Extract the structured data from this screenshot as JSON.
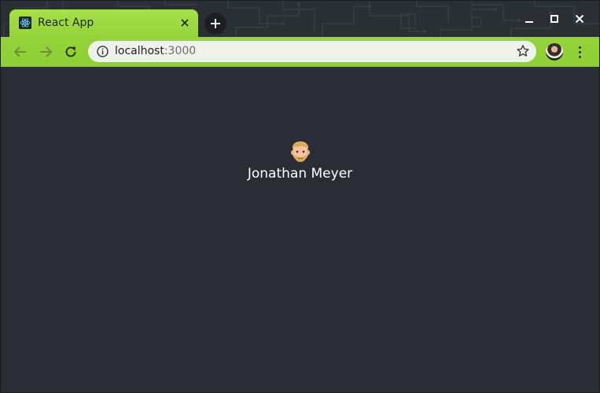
{
  "browser": {
    "tab": {
      "title": "React App",
      "favicon": "react-icon",
      "close_icon": "close-icon"
    },
    "new_tab_icon": "plus-icon",
    "window_controls": [
      "minimize-icon",
      "maximize-icon",
      "close-icon"
    ],
    "toolbar": {
      "back_icon": "arrow-left-icon",
      "forward_icon": "arrow-right-icon",
      "reload_icon": "reload-icon",
      "omnibox": {
        "info_icon": "info-icon",
        "host": "localhost",
        "port": ":3000",
        "bookmark_icon": "star-icon"
      },
      "profile_icon": "avatar",
      "menu_icon": "kebab-menu-icon"
    },
    "theme": {
      "accent": "#9ad63e",
      "titlebar": "#2a2e35",
      "page_background": "#2b2d36"
    }
  },
  "page": {
    "emoji": "person-beard-emoji",
    "name": "Jonathan Meyer",
    "name_color": "#ffffff"
  }
}
